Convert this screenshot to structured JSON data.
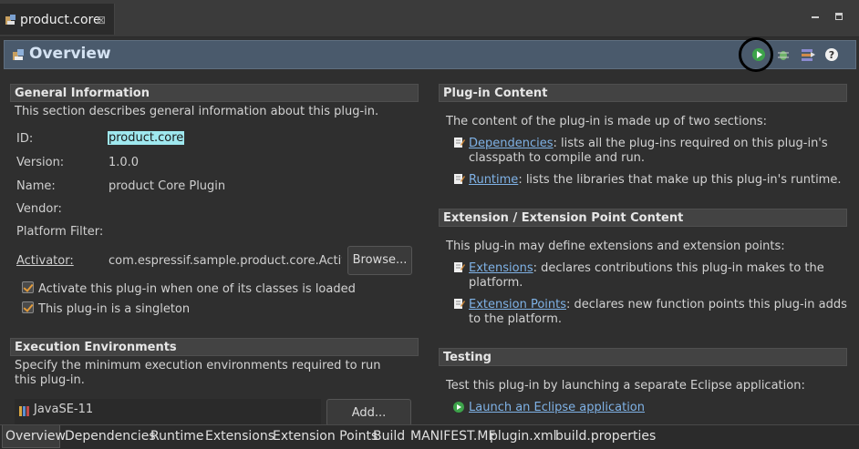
{
  "editor_tab": {
    "label": "product.core",
    "close_glyph": "⊠"
  },
  "header": {
    "title": "Overview",
    "buttons": [
      "run-icon",
      "debug-icon",
      "export-icon",
      "help-icon"
    ]
  },
  "general": {
    "title": "General Information",
    "description": "This section describes general information about this plug-in.",
    "fields": {
      "id_label": "ID:",
      "id_value": "product.core",
      "version_label": "Version:",
      "version_value": "1.0.0",
      "name_label": "Name:",
      "name_value": "product Core Plugin",
      "vendor_label": "Vendor:",
      "platform_label": "Platform Filter:",
      "activator_label": "Activator:",
      "activator_value": "com.espressif.sample.product.core.Activator",
      "browse_label": "Browse..."
    },
    "checkboxes": [
      "Activate this plug-in when one of its classes is loaded",
      "This plug-in is a singleton"
    ]
  },
  "execution": {
    "title": "Execution Environments",
    "description": "Specify the minimum execution environments required to run this plug-in.",
    "item": "JavaSE-11",
    "add_label": "Add..."
  },
  "content": {
    "title": "Plug-in Content",
    "intro": "The content of the plug-in is made up of two sections:",
    "items": [
      {
        "link": "Dependencies",
        "text": ": lists all the plug-ins required on this plug-in's",
        "text2": "classpath to compile and run."
      },
      {
        "link": "Runtime",
        "text": ": lists the libraries that make up this plug-in's runtime.",
        "text2": ""
      }
    ]
  },
  "extension": {
    "title": "Extension / Extension Point Content",
    "intro": "This plug-in may define extensions and extension points:",
    "items": [
      {
        "link": "Extensions",
        "text": ": declares contributions this plug-in makes to the",
        "text2": "platform."
      },
      {
        "link": "Extension Points",
        "text": ": declares new function points this plug-in adds",
        "text2": "to the platform."
      }
    ]
  },
  "testing": {
    "title": "Testing",
    "intro": "Test this plug-in by launching a separate Eclipse application:",
    "launch_link": "Launch an Eclipse application"
  },
  "bottom_tabs": [
    "Overview",
    "Dependencies",
    "Runtime",
    "Extensions",
    "Extension Points",
    "Build",
    "MANIFEST.MF",
    "plugin.xml",
    "build.properties"
  ],
  "colors": {
    "accent": "#4a5a6c",
    "link": "#7fb2e6",
    "highlight": "#9fe8ef"
  }
}
